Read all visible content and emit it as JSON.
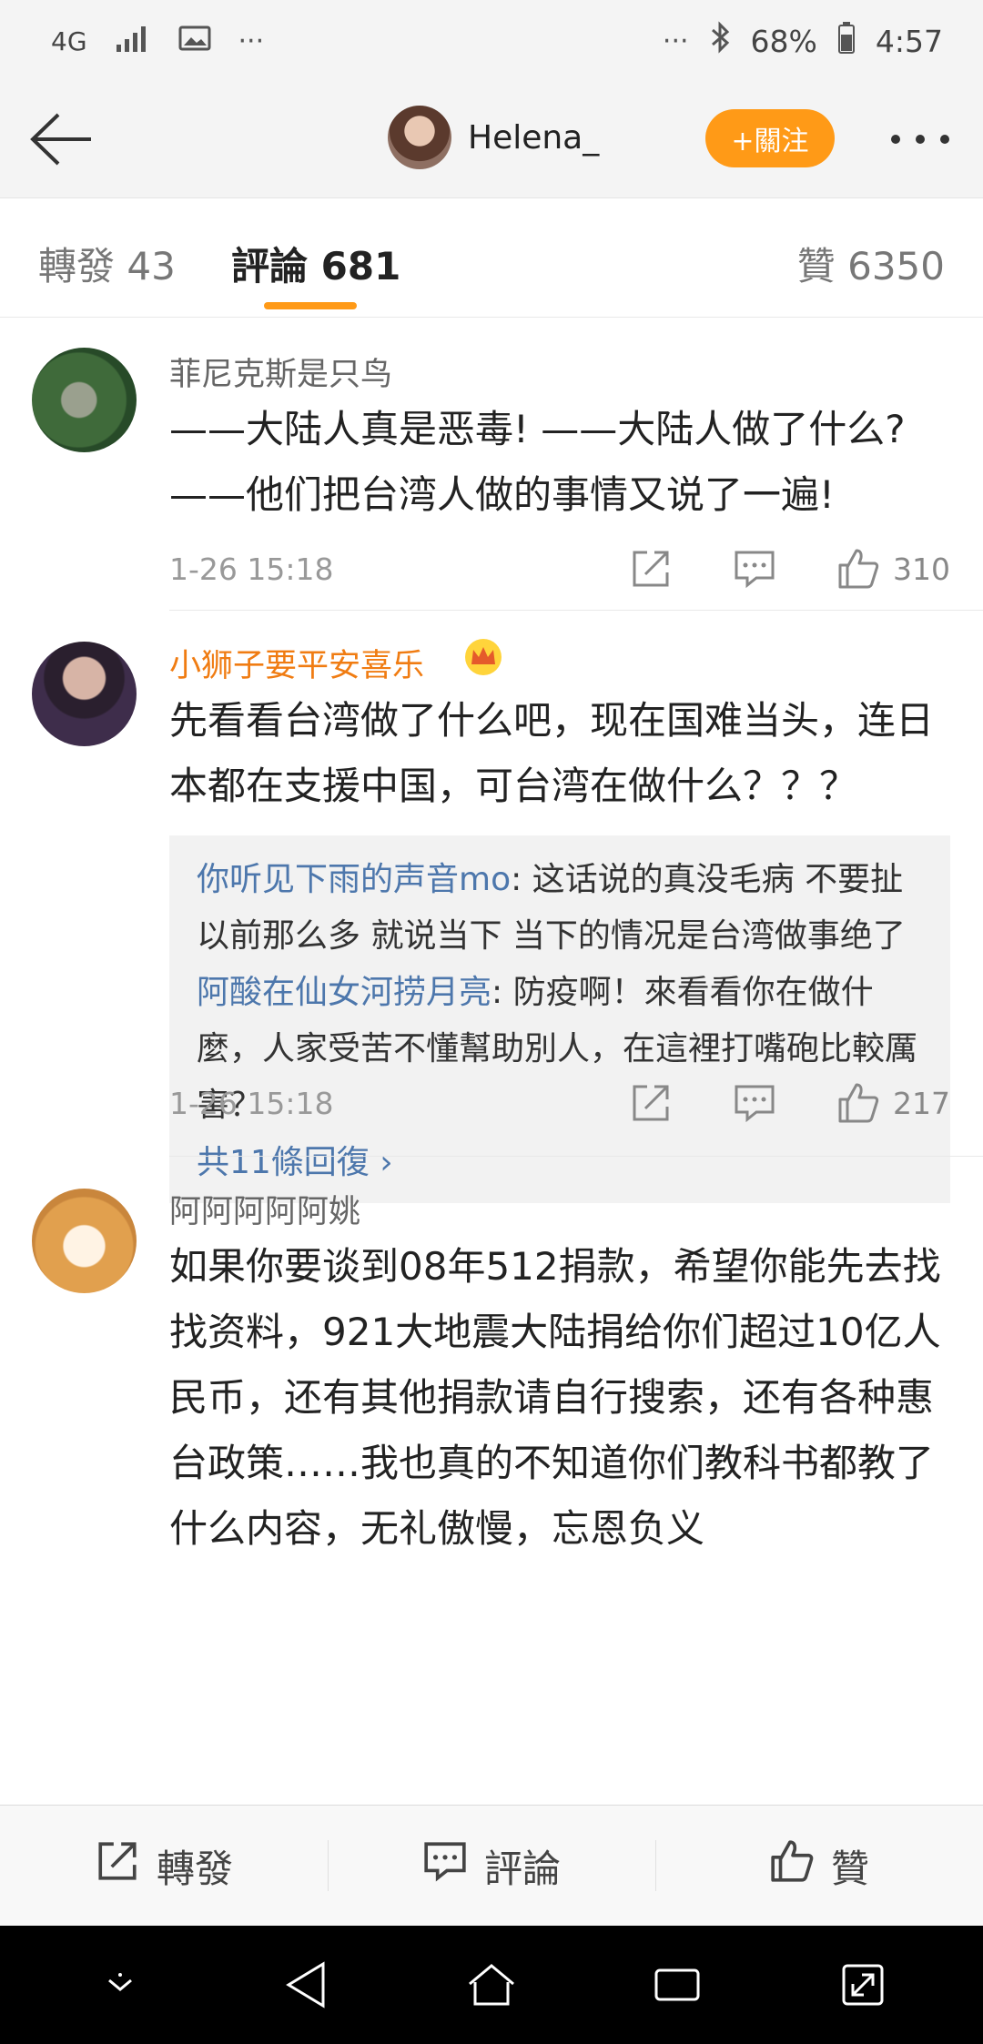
{
  "status_bar": {
    "network": "4G",
    "dots_left": "···",
    "dots_right": "···",
    "battery": "68%",
    "time": "4:57"
  },
  "header": {
    "profile_name": "Helena_",
    "follow_label": "+關注"
  },
  "tabs": {
    "repost": "轉發 43",
    "comments": "評論 681",
    "likes": "贊 6350"
  },
  "comments": [
    {
      "user": "菲尼克斯是只鸟",
      "text": "——大陆人真是恶毒! ——大陆人做了什么? ——他们把台湾人做的事情又说了一遍!",
      "time": "1-26 15:18",
      "likes": "310"
    },
    {
      "user": "小狮子要平安喜乐",
      "text": "先看看台湾做了什么吧，现在国难当头，连日本都在支援中国，可台湾在做什么？？？",
      "time": "1-26 15:18",
      "likes": "217",
      "replies": [
        {
          "user": "你听见下雨的声音mo",
          "text": ": 这话说的真没毛病 不要扯以前那么多 就说当下 当下的情况是台湾做事绝了"
        },
        {
          "user": "阿酸在仙女河捞月亮",
          "text": ": 防疫啊！來看看你在做什麼，人家受苦不懂幫助別人，在這裡打嘴砲比較厲害？"
        }
      ],
      "more_replies": "共11條回復 ›"
    },
    {
      "user": "阿阿阿阿阿姚",
      "text": "如果你要谈到08年512捐款，希望你能先去找找资料，921大地震大陆捐给你们超过10亿人民币，还有其他捐款请自行搜索，还有各种惠台政策……我也真的不知道你们教科书都教了什么内容，无礼傲慢，忘恩负义"
    }
  ],
  "bottom_bar": {
    "repost": "轉發",
    "comment": "評論",
    "like": "贊"
  },
  "colors": {
    "accent": "#ff9a17",
    "link_blue": "#4d77ac",
    "vip_orange": "#f07c12"
  }
}
